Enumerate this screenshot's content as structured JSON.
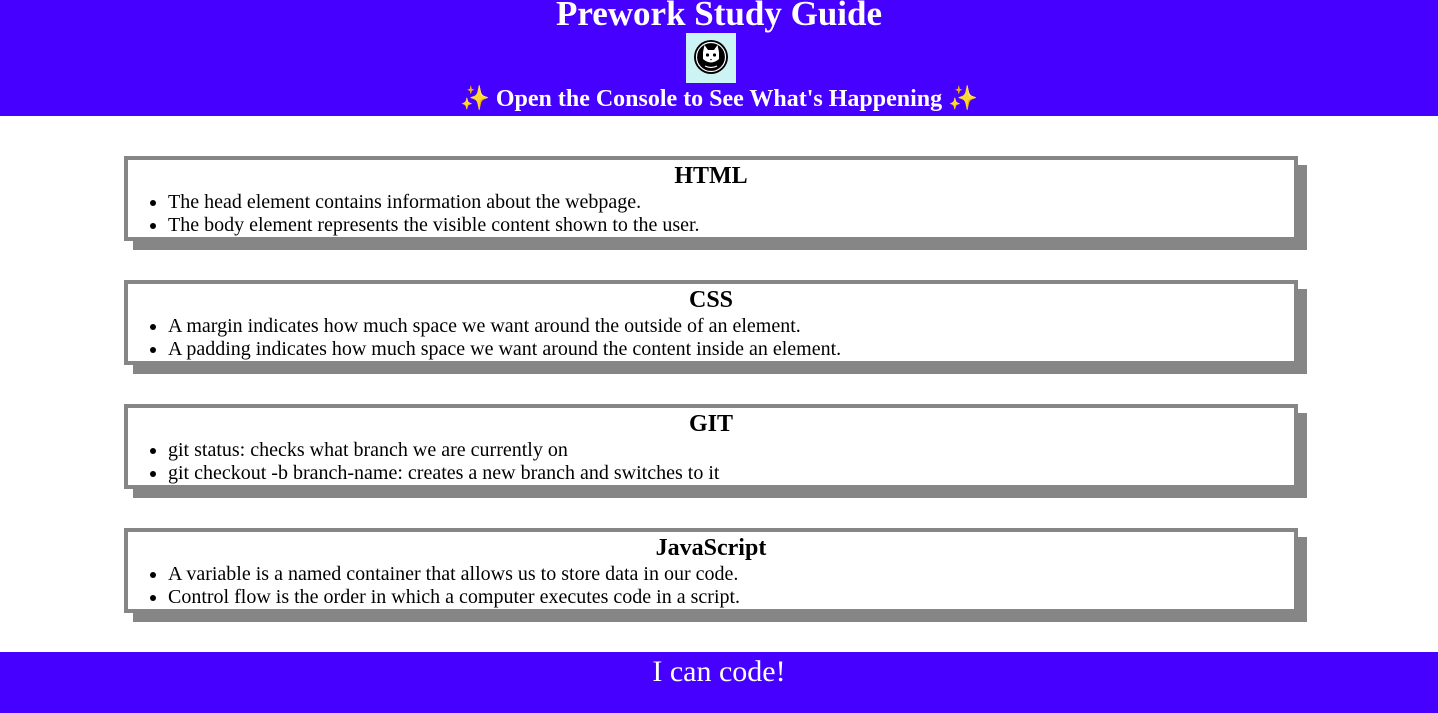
{
  "header": {
    "title": "Prework Study Guide",
    "subtitle_sparkle_left": "✨",
    "subtitle": "Open the Console to See What's Happening",
    "subtitle_sparkle_right": "✨",
    "avatar_icon": "cat-face-icon"
  },
  "sections": [
    {
      "title": "HTML",
      "items": [
        "The head element contains information about the webpage.",
        "The body element represents the visible content shown to the user."
      ]
    },
    {
      "title": "CSS",
      "items": [
        "A margin indicates how much space we want around the outside of an element.",
        "A padding indicates how much space we want around the content inside an element."
      ]
    },
    {
      "title": "GIT",
      "items": [
        "git status: checks what branch we are currently on",
        "git checkout -b branch-name: creates a new branch and switches to it"
      ]
    },
    {
      "title": "JavaScript",
      "items": [
        "A variable is a named container that allows us to store data in our code.",
        "Control flow is the order in which a computer executes code in a script."
      ]
    }
  ],
  "footer": {
    "text": "I can code!"
  },
  "colors": {
    "brand": "#4600ff",
    "card_border": "#868686",
    "avatar_bg": "#cdf4f4"
  }
}
